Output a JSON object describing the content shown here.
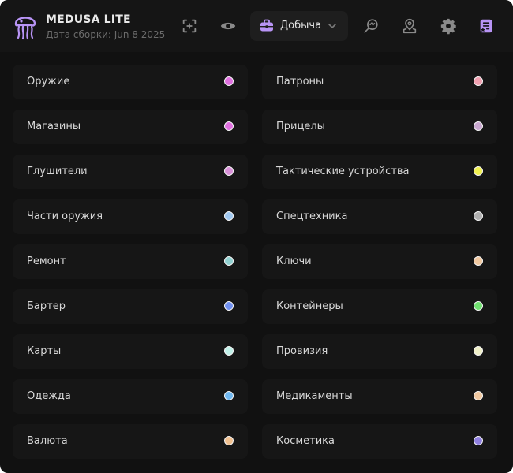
{
  "app": {
    "title": "MEDUSA LITE",
    "build_date": "Дата сборки: Jun 8 2025"
  },
  "header": {
    "icons": [
      "add-target-icon",
      "eye-icon",
      "search-icon",
      "map-pin-icon",
      "gear-icon",
      "checklist-star-icon"
    ],
    "dropdown": {
      "icon": "briefcase-icon",
      "label": "Добыча"
    }
  },
  "colors": {
    "accent": "#b894f5",
    "background": "#111111",
    "card": "#161616"
  },
  "categories": [
    {
      "label": "Оружие",
      "color": "#e070e0"
    },
    {
      "label": "Патроны",
      "color": "#f0a0b0"
    },
    {
      "label": "Магазины",
      "color": "#e070e0"
    },
    {
      "label": "Прицелы",
      "color": "#c8a8d0"
    },
    {
      "label": "Глушители",
      "color": "#d890d8"
    },
    {
      "label": "Тактические устройства",
      "color": "#f0f050"
    },
    {
      "label": "Части оружия",
      "color": "#a0c8f0"
    },
    {
      "label": "Спецтехника",
      "color": "#b0b0b0"
    },
    {
      "label": "Ремонт",
      "color": "#90d0d0"
    },
    {
      "label": "Ключи",
      "color": "#f0c8a0"
    },
    {
      "label": "Бартер",
      "color": "#7090f0"
    },
    {
      "label": "Контейнеры",
      "color": "#70e070"
    },
    {
      "label": "Карты",
      "color": "#c0f0e8"
    },
    {
      "label": "Провизия",
      "color": "#f0f0c8"
    },
    {
      "label": "Одежда",
      "color": "#70b8f0"
    },
    {
      "label": "Медикаменты",
      "color": "#f0c8a0"
    },
    {
      "label": "Валюта",
      "color": "#f0c090"
    },
    {
      "label": "Косметика",
      "color": "#9080e0"
    }
  ]
}
